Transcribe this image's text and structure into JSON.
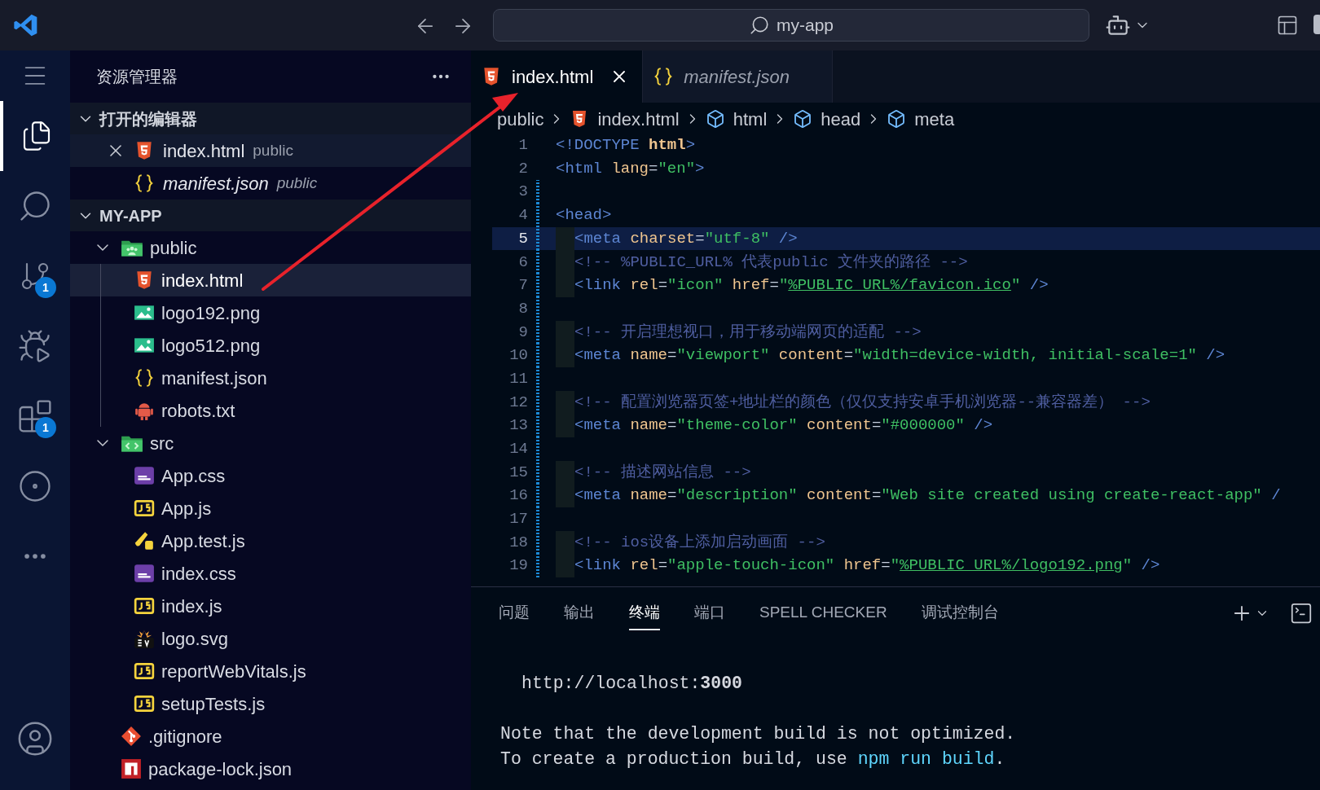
{
  "title_bar": {
    "search": "my-app"
  },
  "activity_bar": [
    {
      "kind": "menu",
      "selected": false
    },
    {
      "kind": "explorer",
      "selected": true
    },
    {
      "kind": "search",
      "selected": false
    },
    {
      "kind": "source-control",
      "selected": false,
      "badge": "1"
    },
    {
      "kind": "run",
      "selected": false
    },
    {
      "kind": "extensions",
      "selected": false,
      "badge": "1"
    },
    {
      "kind": "remote",
      "selected": false
    },
    {
      "kind": "more",
      "selected": false
    },
    {
      "kind": "account",
      "selected": false
    }
  ],
  "sidebar": {
    "title": "资源管理器",
    "sections": [
      {
        "kind": "open-editors",
        "title": "打开的编辑器",
        "expanded": true,
        "items": [
          {
            "name": "index.html",
            "folder": "public",
            "kind": "html",
            "preview": false,
            "selected": true
          },
          {
            "name": "manifest.json",
            "folder": "public",
            "kind": "json",
            "preview": true,
            "selected": false
          }
        ]
      },
      {
        "kind": "folder",
        "title": "MY-APP",
        "expanded": true,
        "children": [
          {
            "name": "public",
            "kind": "folder-public",
            "expanded": true,
            "selected": false,
            "children": [
              {
                "name": "index.html",
                "kind": "html",
                "selected": true
              },
              {
                "name": "logo192.png",
                "kind": "image",
                "selected": false
              },
              {
                "name": "logo512.png",
                "kind": "image",
                "selected": false
              },
              {
                "name": "manifest.json",
                "kind": "json",
                "selected": false
              },
              {
                "name": "robots.txt",
                "kind": "robot",
                "selected": false
              }
            ]
          },
          {
            "name": "src",
            "kind": "folder-src",
            "expanded": true,
            "selected": false,
            "children": [
              {
                "name": "App.css",
                "kind": "css",
                "selected": false
              },
              {
                "name": "App.js",
                "kind": "js",
                "selected": false
              },
              {
                "name": "App.test.js",
                "kind": "test",
                "selected": false
              },
              {
                "name": "index.css",
                "kind": "css",
                "selected": false
              },
              {
                "name": "index.js",
                "kind": "js",
                "selected": false
              },
              {
                "name": "logo.svg",
                "kind": "svg",
                "selected": false
              },
              {
                "name": "reportWebVitals.js",
                "kind": "js",
                "selected": false
              },
              {
                "name": "setupTests.js",
                "kind": "js",
                "selected": false
              }
            ]
          },
          {
            "name": ".gitignore",
            "kind": "git",
            "selected": false
          },
          {
            "name": "package-lock.json",
            "kind": "npm",
            "selected": false
          }
        ]
      }
    ]
  },
  "editor": {
    "tabs": [
      {
        "name": "index.html",
        "kind": "html",
        "selected": true,
        "preview": false
      },
      {
        "name": "manifest.json",
        "kind": "json",
        "selected": false,
        "preview": true
      }
    ],
    "breadcrumb": [
      {
        "text": "public",
        "kind": "folder"
      },
      {
        "text": "index.html",
        "kind": "html"
      },
      {
        "text": "html",
        "kind": "element"
      },
      {
        "text": "head",
        "kind": "element"
      },
      {
        "text": "meta",
        "kind": "element"
      }
    ],
    "lines": [
      {
        "number": "1",
        "current": false,
        "modified": false,
        "indented": false,
        "tokens": [
          {
            "kind": "tag",
            "text": "<!DOCTYPE"
          },
          {
            "kind": "keyword",
            "text": " html"
          },
          {
            "kind": "tag",
            "text": ">"
          }
        ]
      },
      {
        "number": "2",
        "current": false,
        "modified": false,
        "indented": false,
        "tokens": [
          {
            "kind": "tag",
            "text": "<html"
          },
          {
            "kind": "attr",
            "text": " lang"
          },
          {
            "kind": "op",
            "text": "="
          },
          {
            "kind": "string",
            "text": "\"en\""
          },
          {
            "kind": "tag",
            "text": ">"
          }
        ]
      },
      {
        "number": "3",
        "current": false,
        "modified": true,
        "indented": false
      },
      {
        "number": "4",
        "current": false,
        "modified": true,
        "indented": false,
        "tokens": [
          {
            "kind": "tag",
            "text": "<head>"
          }
        ]
      },
      {
        "number": "5",
        "current": true,
        "modified": true,
        "indented": true,
        "tokens": [
          {
            "kind": "tag",
            "text": "<meta"
          },
          {
            "kind": "attr",
            "text": " charset"
          },
          {
            "kind": "op",
            "text": "="
          },
          {
            "kind": "string",
            "text": "\"utf-8\""
          },
          {
            "kind": "tag",
            "text": " />"
          }
        ]
      },
      {
        "number": "6",
        "current": false,
        "modified": true,
        "indented": true,
        "tokens": [
          {
            "kind": "comment",
            "text": "<!-- %PUBLIC_URL% 代表public 文件夹的路径 -->"
          }
        ]
      },
      {
        "number": "7",
        "current": false,
        "modified": true,
        "indented": true,
        "tokens": [
          {
            "kind": "tag",
            "text": "<link"
          },
          {
            "kind": "attr",
            "text": " rel"
          },
          {
            "kind": "op",
            "text": "="
          },
          {
            "kind": "string",
            "text": "\"icon\""
          },
          {
            "kind": "attr",
            "text": " href"
          },
          {
            "kind": "op",
            "text": "="
          },
          {
            "kind": "string",
            "text": "\""
          },
          {
            "kind": "link",
            "text": "%PUBLIC_URL%/favicon.ico"
          },
          {
            "kind": "string",
            "text": "\""
          },
          {
            "kind": "tag",
            "text": " />"
          }
        ]
      },
      {
        "number": "8",
        "current": false,
        "modified": true,
        "indented": false
      },
      {
        "number": "9",
        "current": false,
        "modified": true,
        "indented": true,
        "tokens": [
          {
            "kind": "comment",
            "text": "<!-- 开启理想视口，用于移动端网页的适配 -->"
          }
        ]
      },
      {
        "number": "10",
        "current": false,
        "modified": true,
        "indented": true,
        "tokens": [
          {
            "kind": "tag",
            "text": "<meta"
          },
          {
            "kind": "attr",
            "text": " name"
          },
          {
            "kind": "op",
            "text": "="
          },
          {
            "kind": "string",
            "text": "\"viewport\""
          },
          {
            "kind": "attr",
            "text": " content"
          },
          {
            "kind": "op",
            "text": "="
          },
          {
            "kind": "string",
            "text": "\"width=device-width, initial-scale=1\""
          },
          {
            "kind": "tag",
            "text": " />"
          }
        ]
      },
      {
        "number": "11",
        "current": false,
        "modified": true,
        "indented": false
      },
      {
        "number": "12",
        "current": false,
        "modified": true,
        "indented": true,
        "tokens": [
          {
            "kind": "comment",
            "text": "<!-- 配置浏览器页签+地址栏的颜色（仅仅支持安卓手机浏览器--兼容器差） -->"
          }
        ]
      },
      {
        "number": "13",
        "current": false,
        "modified": true,
        "indented": true,
        "tokens": [
          {
            "kind": "tag",
            "text": "<meta"
          },
          {
            "kind": "attr",
            "text": " name"
          },
          {
            "kind": "op",
            "text": "="
          },
          {
            "kind": "string",
            "text": "\"theme-color\""
          },
          {
            "kind": "attr",
            "text": " content"
          },
          {
            "kind": "op",
            "text": "="
          },
          {
            "kind": "string",
            "text": "\"#000000\""
          },
          {
            "kind": "tag",
            "text": " />"
          }
        ]
      },
      {
        "number": "14",
        "current": false,
        "modified": true,
        "indented": false
      },
      {
        "number": "15",
        "current": false,
        "modified": true,
        "indented": true,
        "tokens": [
          {
            "kind": "comment",
            "text": "<!-- 描述网站信息 -->"
          }
        ]
      },
      {
        "number": "16",
        "current": false,
        "modified": true,
        "indented": true,
        "tokens": [
          {
            "kind": "tag",
            "text": "<meta"
          },
          {
            "kind": "attr",
            "text": " name"
          },
          {
            "kind": "op",
            "text": "="
          },
          {
            "kind": "string",
            "text": "\"description\""
          },
          {
            "kind": "attr",
            "text": " content"
          },
          {
            "kind": "op",
            "text": "="
          },
          {
            "kind": "string",
            "text": "\"Web site created using create-react-app\""
          },
          {
            "kind": "tag",
            "text": " /"
          }
        ]
      },
      {
        "number": "17",
        "current": false,
        "modified": true,
        "indented": false
      },
      {
        "number": "18",
        "current": false,
        "modified": true,
        "indented": true,
        "tokens": [
          {
            "kind": "comment",
            "text": "<!-- ios设备上添加启动画面 -->"
          }
        ]
      },
      {
        "number": "19",
        "current": false,
        "modified": true,
        "indented": true,
        "tokens": [
          {
            "kind": "tag",
            "text": "<link"
          },
          {
            "kind": "attr",
            "text": " rel"
          },
          {
            "kind": "op",
            "text": "="
          },
          {
            "kind": "string",
            "text": "\"apple-touch-icon\""
          },
          {
            "kind": "attr",
            "text": " href"
          },
          {
            "kind": "op",
            "text": "="
          },
          {
            "kind": "string",
            "text": "\""
          },
          {
            "kind": "link",
            "text": "%PUBLIC_URL%/logo192.png"
          },
          {
            "kind": "string",
            "text": "\""
          },
          {
            "kind": "tag",
            "text": " />"
          }
        ]
      }
    ]
  },
  "panel": {
    "tabs": [
      {
        "label": "问题",
        "selected": false
      },
      {
        "label": "输出",
        "selected": false
      },
      {
        "label": "终端",
        "selected": true
      },
      {
        "label": "端口",
        "selected": false
      },
      {
        "label": "SPELL CHECKER",
        "selected": false
      },
      {
        "label": "调试控制台",
        "selected": false
      }
    ],
    "terminal": [
      {
        "kind": "indented",
        "segments": [
          {
            "kind": "plain",
            "text": "http://localhost:"
          },
          {
            "kind": "bold",
            "text": "3000"
          }
        ]
      },
      {
        "kind": "blank"
      },
      {
        "kind": "text",
        "segments": [
          {
            "kind": "plain",
            "text": "Note that the development build is not optimized."
          }
        ]
      },
      {
        "kind": "text",
        "segments": [
          {
            "kind": "plain",
            "text": "To create a production build, use "
          },
          {
            "kind": "command",
            "text": "npm run build"
          },
          {
            "kind": "plain",
            "text": "."
          }
        ]
      }
    ]
  }
}
